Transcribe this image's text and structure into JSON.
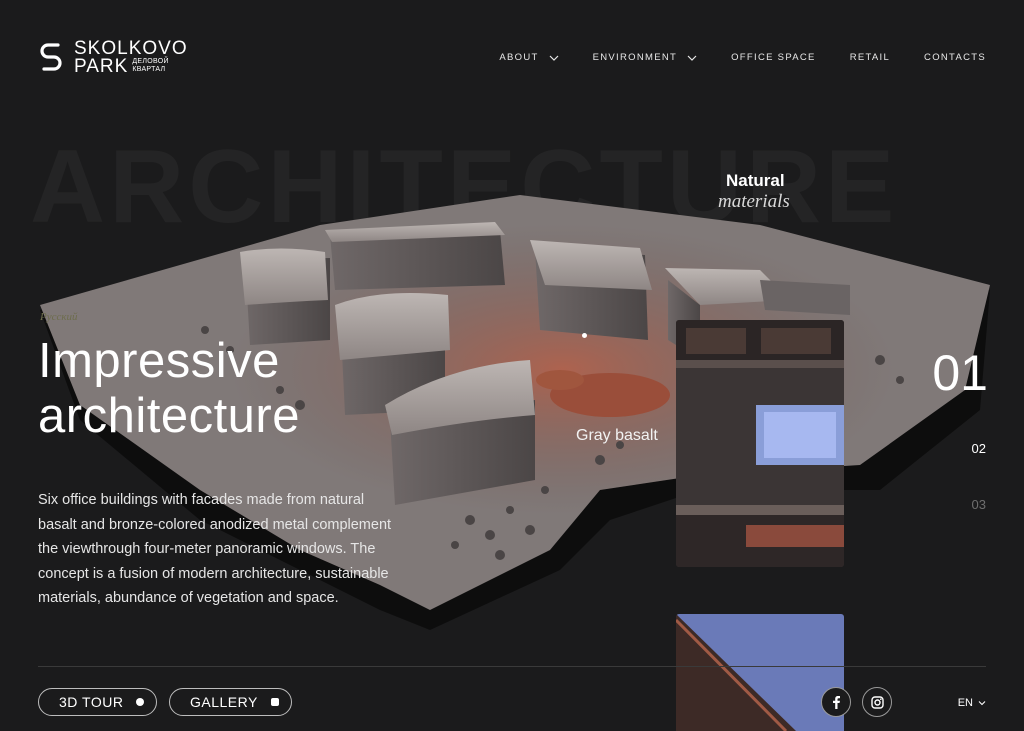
{
  "logo": {
    "line1": "SKOLKOVO",
    "line2": "PARK",
    "sub": "ДЕЛОВОЙ КВАРТАЛ"
  },
  "nav": [
    {
      "label": "ABOUT",
      "has_dropdown": true
    },
    {
      "label": "ENVIRONMENT",
      "has_dropdown": true
    },
    {
      "label": "OFFICE SPACE",
      "has_dropdown": false
    },
    {
      "label": "RETAIL",
      "has_dropdown": false
    },
    {
      "label": "CONTACTS",
      "has_dropdown": false
    }
  ],
  "background_word": "ARCHITECTURE",
  "materials": {
    "line1": "Natural",
    "line2": "materials"
  },
  "section_tag": "Русский",
  "hero": {
    "title_line1": "Impressive",
    "title_line2": "architecture",
    "description": "Six office buildings with facades made from natural basalt and bronze-colored anodized metal complement the viewthrough four-meter panoramic windows. The concept is a fusion of modern architecture, sustainable materials, abundance of vegetation and space."
  },
  "swatch": {
    "label": "Gray basalt"
  },
  "counter": {
    "current": "01",
    "next": "02",
    "last": "03"
  },
  "buttons": {
    "tour": "3D TOUR",
    "gallery": "GALLERY"
  },
  "social": {
    "facebook_icon": "facebook-icon",
    "instagram_icon": "instagram-icon"
  },
  "language": "EN",
  "colors": {
    "background": "#1b1b1c",
    "accent_copper": "#a0563e",
    "text": "#ffffff"
  }
}
